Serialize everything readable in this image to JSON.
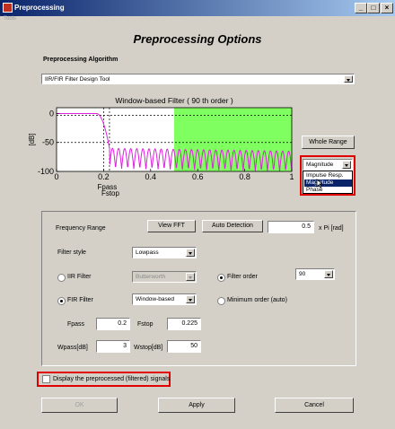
{
  "window": {
    "title": "Preprocessing",
    "controls": {
      "minimize": "_",
      "maximize": "□",
      "close": "×"
    }
  },
  "menu": {
    "tools": "Tools"
  },
  "header": {
    "title": "Preprocessing Options"
  },
  "algorithm": {
    "label": "Preprocessing Algorithm",
    "selected": "IIR/FIR Filter Design Tool"
  },
  "plot": {
    "whole_range_label": "Whole Range",
    "display": {
      "selected": "Magnitude",
      "options": [
        "Impulse Resp.",
        "Magnitude",
        "Phase"
      ]
    }
  },
  "chart_data": {
    "type": "line",
    "title": "Window-based Filter  ( 90 th order )",
    "xlabel": "",
    "ylabel": "[dB]",
    "xlim": [
      0,
      1
    ],
    "ylim": [
      -100,
      10
    ],
    "xticks": [
      0,
      0.2,
      0.4,
      0.6,
      0.8,
      1
    ],
    "yticks": [
      0,
      -50,
      -100
    ],
    "ytick_labels": [
      "0",
      "-50",
      "-100"
    ],
    "markers": [
      {
        "x": 0.2,
        "label": "Fpass"
      },
      {
        "x": 0.225,
        "label": "Fstop"
      }
    ],
    "highlight_region": {
      "x_start": 0.5,
      "x_end": 1.0,
      "color": "#80ff60"
    },
    "dashed_levels": [
      -3,
      -50
    ],
    "grid": false,
    "series": [
      {
        "color": "#e020e0",
        "passband_edge": 0.2,
        "stopband_start": 0.225,
        "passband_level": 0,
        "stopband_level": -60,
        "lobes": 30
      }
    ]
  },
  "frequency_range": {
    "label": "Frequency Range",
    "view_fft_label": "View FFT",
    "auto_detection_label": "Auto Detection",
    "value": "0.5",
    "unit": "x Pi [rad]"
  },
  "filter_style": {
    "label": "Filter style",
    "selected": "Lowpass"
  },
  "iir": {
    "label": "IIR Filter",
    "type_selected": "Butterworth"
  },
  "fir": {
    "label": "FIR Filter",
    "type_selected": "Window-based"
  },
  "order": {
    "filter_order_label": "Filter order",
    "filter_order_value": "90",
    "minimum_order_label": "Minimum order (auto)"
  },
  "params": {
    "fpass_label": "Fpass",
    "fpass_value": "0.2",
    "fstop_label": "Fstop",
    "fstop_value": "0.225",
    "wpass_label": "Wpass[dB]",
    "wpass_value": "3",
    "wstop_label": "Wstop[dB]",
    "wstop_value": "50"
  },
  "display_signals": {
    "label": "Display the preprocessed (filtered) signals"
  },
  "buttons": {
    "ok": "OK",
    "apply": "Apply",
    "cancel": "Cancel"
  }
}
